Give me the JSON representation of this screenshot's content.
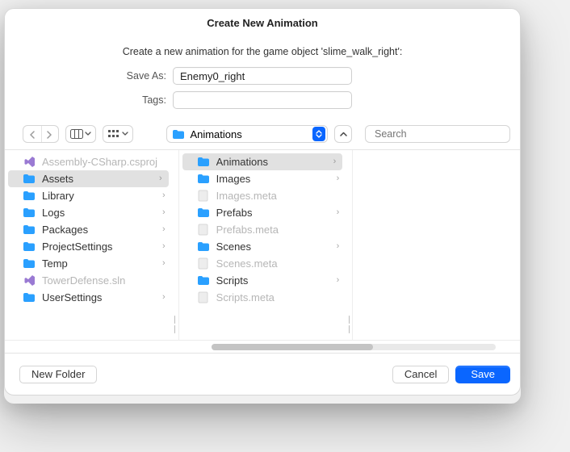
{
  "dialog": {
    "title": "Create New Animation",
    "subtitle": "Create a new animation for the game object 'slime_walk_right':"
  },
  "form": {
    "saveas_label": "Save As:",
    "saveas_value": "Enemy0_right",
    "tags_label": "Tags:",
    "tags_value": ""
  },
  "location_popup": {
    "label": "Animations",
    "icon": "folder"
  },
  "search": {
    "placeholder": "Search"
  },
  "columns": [
    {
      "items": [
        {
          "icon": "vs",
          "label": "Assembly-CSharp.csproj",
          "muted": true,
          "chevron": false,
          "selected": false
        },
        {
          "icon": "folder",
          "label": "Assets",
          "muted": false,
          "chevron": true,
          "selected": true
        },
        {
          "icon": "folder",
          "label": "Library",
          "muted": false,
          "chevron": true,
          "selected": false
        },
        {
          "icon": "folder",
          "label": "Logs",
          "muted": false,
          "chevron": true,
          "selected": false
        },
        {
          "icon": "folder",
          "label": "Packages",
          "muted": false,
          "chevron": true,
          "selected": false
        },
        {
          "icon": "folder",
          "label": "ProjectSettings",
          "muted": false,
          "chevron": true,
          "selected": false
        },
        {
          "icon": "folder",
          "label": "Temp",
          "muted": false,
          "chevron": true,
          "selected": false
        },
        {
          "icon": "vs",
          "label": "TowerDefense.sln",
          "muted": true,
          "chevron": false,
          "selected": false
        },
        {
          "icon": "folder",
          "label": "UserSettings",
          "muted": false,
          "chevron": true,
          "selected": false
        }
      ]
    },
    {
      "items": [
        {
          "icon": "folder",
          "label": "Animations",
          "muted": false,
          "chevron": true,
          "selected": true
        },
        {
          "icon": "folder",
          "label": "Images",
          "muted": false,
          "chevron": true,
          "selected": false
        },
        {
          "icon": "file",
          "label": "Images.meta",
          "muted": true,
          "chevron": false,
          "selected": false
        },
        {
          "icon": "folder",
          "label": "Prefabs",
          "muted": false,
          "chevron": true,
          "selected": false
        },
        {
          "icon": "file",
          "label": "Prefabs.meta",
          "muted": true,
          "chevron": false,
          "selected": false
        },
        {
          "icon": "folder",
          "label": "Scenes",
          "muted": false,
          "chevron": true,
          "selected": false
        },
        {
          "icon": "file",
          "label": "Scenes.meta",
          "muted": true,
          "chevron": false,
          "selected": false
        },
        {
          "icon": "folder",
          "label": "Scripts",
          "muted": false,
          "chevron": true,
          "selected": false
        },
        {
          "icon": "file",
          "label": "Scripts.meta",
          "muted": true,
          "chevron": false,
          "selected": false
        }
      ]
    }
  ],
  "footer": {
    "new_folder": "New Folder",
    "cancel": "Cancel",
    "save": "Save"
  }
}
